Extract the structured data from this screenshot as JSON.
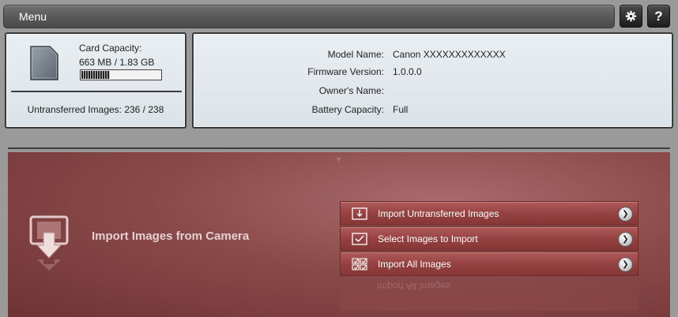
{
  "header": {
    "title": "Menu",
    "settings_icon": "gear-icon",
    "help_icon": "help-icon",
    "help_glyph": "?"
  },
  "card": {
    "capacity_label": "Card Capacity:",
    "capacity_value": "663 MB / 1.83 GB",
    "used_fraction": 0.36,
    "untransferred": "Untransferred Images: 236 / 238",
    "icon": "sd-card-icon"
  },
  "camera_info": {
    "rows": [
      {
        "key": "Model Name:",
        "value": "Canon XXXXXXXXXXXXX"
      },
      {
        "key": "Firmware Version:",
        "value": "1.0.0.0"
      },
      {
        "key": "Owner's Name:",
        "value": ""
      },
      {
        "key": "Battery Capacity:",
        "value": "Full"
      }
    ]
  },
  "import": {
    "title": "Import Images from Camera",
    "icon": "import-camera-icon",
    "collapse_glyph": "▼",
    "actions": [
      {
        "label": "Import Untransferred Images",
        "icon": "import-untransferred-icon"
      },
      {
        "label": "Select Images to Import",
        "icon": "checkbox-select-icon"
      },
      {
        "label": "Import All Images",
        "icon": "import-all-icon"
      }
    ],
    "reflection_text": "Import All Images"
  },
  "colors": {
    "accent": "#944040",
    "panel": "#e3e9ee"
  }
}
